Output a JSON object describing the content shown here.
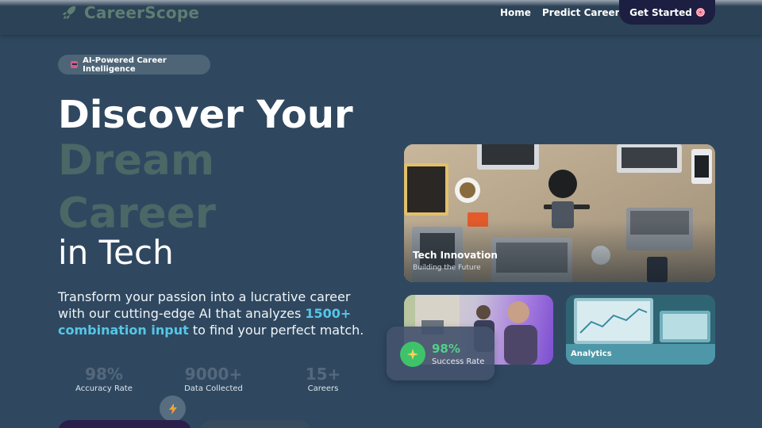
{
  "nav": {
    "brand": "CareerScope",
    "brand_icon": "rocket-icon",
    "links": [
      "Home",
      "Predict Career"
    ],
    "cta_label": "Get Started",
    "cta_icon": "target-icon"
  },
  "hero": {
    "badge": "AI-Powered Career Intelligence",
    "badge_icon": "robot-icon",
    "title_line1": "Discover Your",
    "title_line2": "Dream",
    "title_line3": "Career",
    "title_line4": "in Tech",
    "description_before": "Transform your passion into a lucrative career with our cutting-edge AI that analyzes ",
    "description_highlight": "1500+ combination input",
    "description_after": " to find your perfect match."
  },
  "stats": [
    {
      "value": "98%",
      "label": "Accuracy Rate"
    },
    {
      "value": "9000+",
      "label": "Data Collected"
    },
    {
      "value": "15+",
      "label": "Careers"
    }
  ],
  "cards": {
    "main_title": "Tech Innovation",
    "main_subtitle": "Building the Future",
    "analytics_label": "Analytics"
  },
  "success": {
    "value": "98%",
    "label": "Success Rate",
    "icon": "sparkle-icon"
  },
  "colors": {
    "background": "#2f4860",
    "accent": "#56c6e6",
    "muted_title": "#4b6766",
    "success": "#3fc36a",
    "cta": "#1c1e42"
  }
}
